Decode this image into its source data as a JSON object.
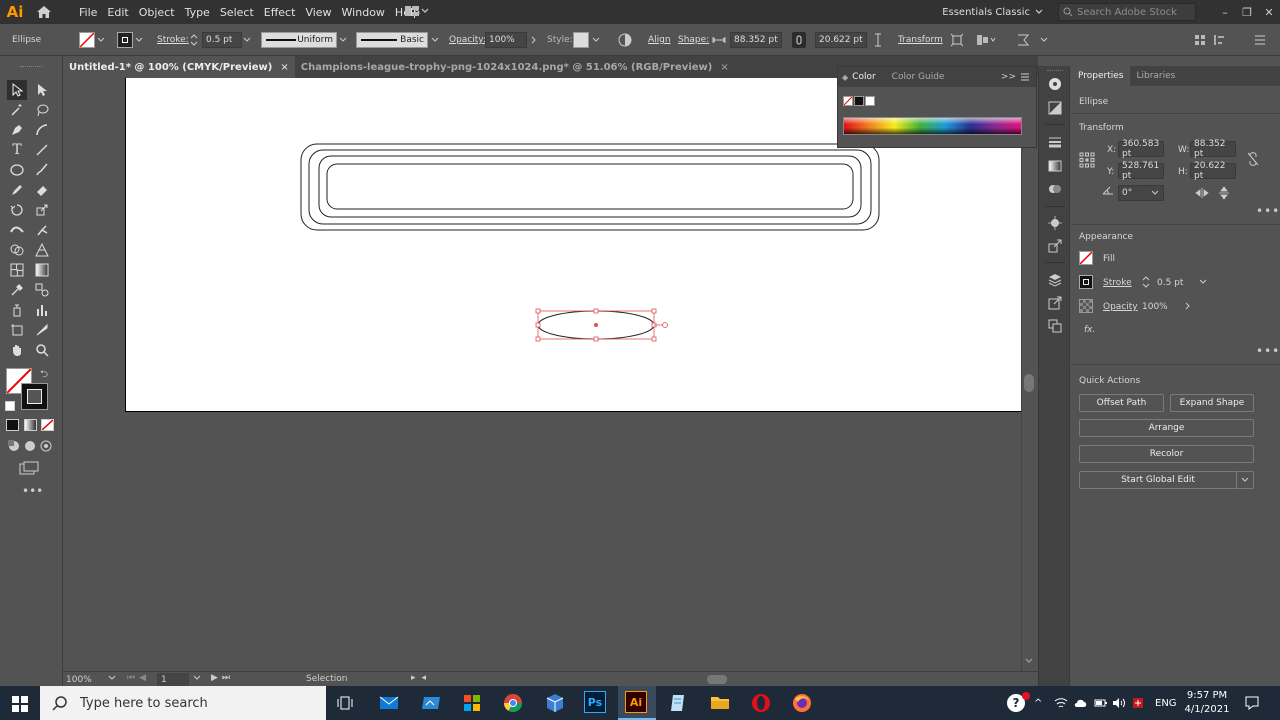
{
  "app": {
    "logo": "Ai",
    "workspace": "Essentials Classic",
    "search_placeholder": "Search Adobe Stock"
  },
  "menu": [
    "File",
    "Edit",
    "Object",
    "Type",
    "Select",
    "Effect",
    "View",
    "Window",
    "Help"
  ],
  "control": {
    "object_type": "Ellipse",
    "stroke_label": "Stroke:",
    "stroke_value": "0.5 pt",
    "profile": "Uniform",
    "brush": "Basic",
    "opacity_label": "Opacity:",
    "opacity_value": "100%",
    "style_label": "Style:",
    "align": "Align",
    "shape": "Shape:",
    "width": "88.352 pt",
    "height": "20.622 pt",
    "transform": "Transform"
  },
  "tabs": [
    {
      "label": "Untitled-1* @ 100% (CMYK/Preview)",
      "close": "×"
    },
    {
      "label": "Champions-league-trophy-png-1024x1024.png* @ 51.06% (RGB/Preview)",
      "close": "×"
    }
  ],
  "status": {
    "zoom": "100%",
    "artboard": "1",
    "tool": "Selection"
  },
  "color_panel": {
    "tab_color": "Color",
    "tab_guide": "Color Guide",
    "expand": ">>"
  },
  "properties": {
    "tab_properties": "Properties",
    "tab_libraries": "Libraries",
    "object": "Ellipse",
    "transform_title": "Transform",
    "x_label": "X:",
    "x_value": "360.583 pt",
    "y_label": "Y:",
    "y_value": "528.761 pt",
    "w_label": "W:",
    "w_value": "88.352 pt",
    "h_label": "H:",
    "h_value": "20.622 pt",
    "angle": "0°",
    "appearance_title": "Appearance",
    "fill_label": "Fill",
    "stroke_label": "Stroke",
    "stroke_value": "0.5 pt",
    "opacity_label": "Opacity",
    "opacity_value": "100%",
    "fx": "fx.",
    "quick_actions_title": "Quick Actions",
    "btn_offset": "Offset Path",
    "btn_expand": "Expand Shape",
    "btn_arrange": "Arrange",
    "btn_recolor": "Recolor",
    "btn_global": "Start Global Edit"
  },
  "taskbar": {
    "search_placeholder": "Type here to search",
    "lang": "ENG",
    "time": "9:57 PM",
    "date": "4/1/2021"
  },
  "colors": {
    "accent": "#ff9a00",
    "selection": "#e0514f",
    "panel": "#535353",
    "dark": "#323232"
  }
}
